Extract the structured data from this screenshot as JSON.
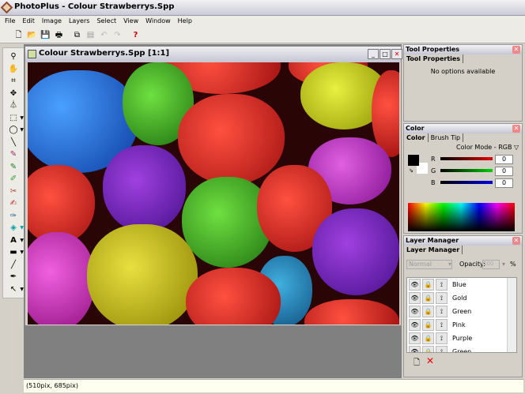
{
  "app": {
    "title": "PhotoPlus - Colour Strawberrys.Spp"
  },
  "menu": [
    "File",
    "Edit",
    "Image",
    "Layers",
    "Select",
    "View",
    "Window",
    "Help"
  ],
  "toolbar": [
    "new-icon",
    "open-icon",
    "save-icon",
    "print-icon",
    "copy-icon",
    "paste-icon",
    "undo-icon",
    "redo-icon",
    "help-icon"
  ],
  "tools": [
    "zoom",
    "hand",
    "crop",
    "move",
    "deform",
    "rect-select",
    "ellipse-select",
    "magic-wand",
    "paintbrush",
    "pencil",
    "clone",
    "eraser",
    "fill-brush",
    "smudge",
    "flood-fill",
    "text",
    "shape",
    "line",
    "color-picker",
    "node-pointer"
  ],
  "document": {
    "title": "Colour Strawberrys.Spp [1:1]"
  },
  "tool_properties": {
    "title": "Tool Properties",
    "tab": "Tool Properties",
    "message": "No options available"
  },
  "color": {
    "title": "Color",
    "tabs": [
      "Color",
      "Brush Tip"
    ],
    "mode": "Color Mode - RGB",
    "r_label": "R",
    "g_label": "G",
    "b_label": "B",
    "r": "0",
    "g": "0",
    "b": "0",
    "foreground": "#000000",
    "background": "#ffffff"
  },
  "layers": {
    "title": "Layer Manager",
    "tab": "Layer Manager",
    "blend_mode": "Normal",
    "opacity_label": "Opacity:",
    "opacity": "100",
    "items": [
      "Blue",
      "Gold",
      "Green",
      "Pink",
      "Purple",
      "Green"
    ]
  },
  "status": {
    "coords": "(510pix, 685pix)"
  }
}
